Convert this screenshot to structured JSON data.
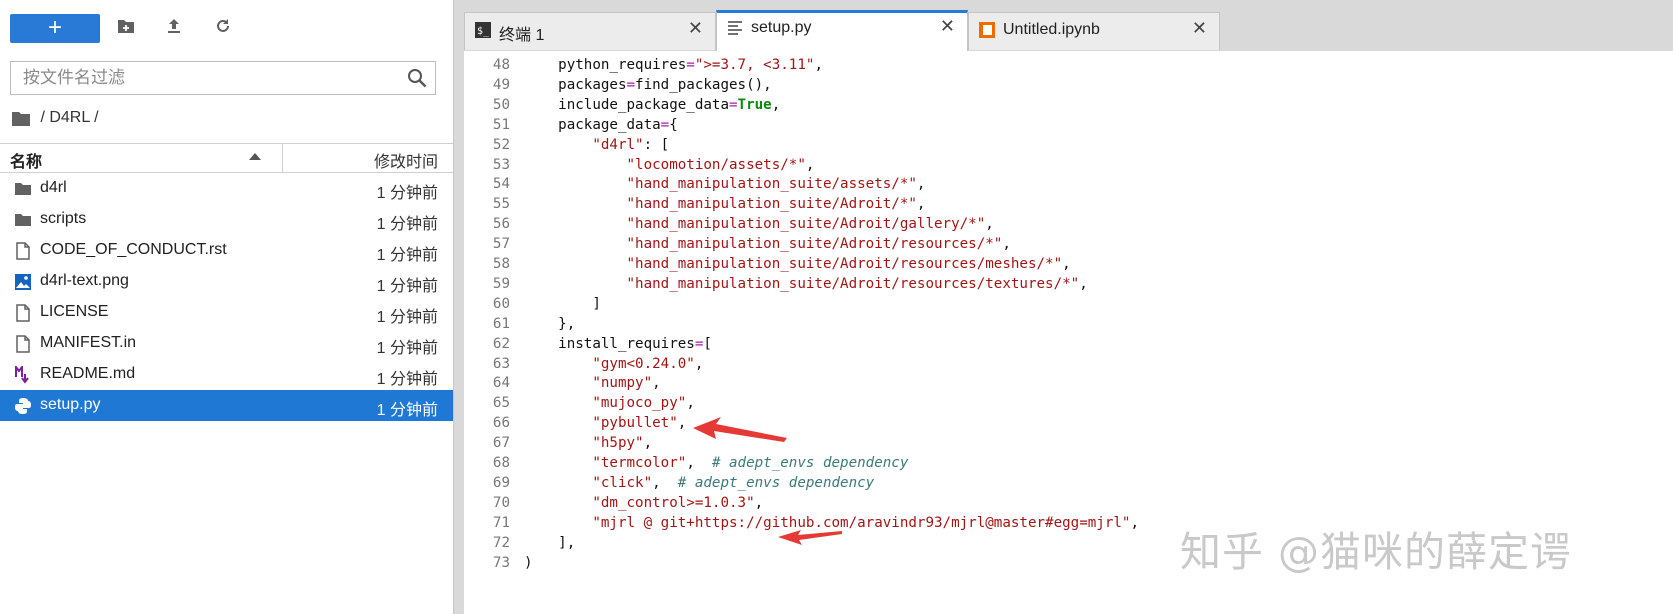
{
  "sidebar": {
    "toolbar": {
      "new_label": "+"
    },
    "filter_placeholder": "按文件名过滤",
    "breadcrumb": "/ D4RL /",
    "header": {
      "name": "名称",
      "modified": "修改时间"
    },
    "files": [
      {
        "name": "d4rl",
        "modified": "1 分钟前",
        "icon": "folder-icon"
      },
      {
        "name": "scripts",
        "modified": "1 分钟前",
        "icon": "folder-icon"
      },
      {
        "name": "CODE_OF_CONDUCT.rst",
        "modified": "1 分钟前",
        "icon": "file-icon"
      },
      {
        "name": "d4rl-text.png",
        "modified": "1 分钟前",
        "icon": "image-icon"
      },
      {
        "name": "LICENSE",
        "modified": "1 分钟前",
        "icon": "file-icon"
      },
      {
        "name": "MANIFEST.in",
        "modified": "1 分钟前",
        "icon": "file-icon"
      },
      {
        "name": "README.md",
        "modified": "1 分钟前",
        "icon": "markdown-icon"
      },
      {
        "name": "setup.py",
        "modified": "1 分钟前",
        "icon": "python-icon",
        "selected": true
      }
    ]
  },
  "tabs": [
    {
      "label": "终端 1",
      "icon": "terminal-icon"
    },
    {
      "label": "setup.py",
      "icon": "text-file-icon",
      "active": true
    },
    {
      "label": "Untitled.ipynb",
      "icon": "notebook-icon"
    }
  ],
  "editor": {
    "lines": [
      {
        "n": "48",
        "code": "    python_requires=\">=3.7, <3.11\","
      },
      {
        "n": "49",
        "code": "    packages=find_packages(),"
      },
      {
        "n": "50",
        "code": "    include_package_data=True,"
      },
      {
        "n": "51",
        "code": "    package_data={"
      },
      {
        "n": "52",
        "code": "        \"d4rl\": ["
      },
      {
        "n": "53",
        "code": "            \"locomotion/assets/*\","
      },
      {
        "n": "54",
        "code": "            \"hand_manipulation_suite/assets/*\","
      },
      {
        "n": "55",
        "code": "            \"hand_manipulation_suite/Adroit/*\","
      },
      {
        "n": "56",
        "code": "            \"hand_manipulation_suite/Adroit/gallery/*\","
      },
      {
        "n": "57",
        "code": "            \"hand_manipulation_suite/Adroit/resources/*\","
      },
      {
        "n": "58",
        "code": "            \"hand_manipulation_suite/Adroit/resources/meshes/*\","
      },
      {
        "n": "59",
        "code": "            \"hand_manipulation_suite/Adroit/resources/textures/*\","
      },
      {
        "n": "60",
        "code": "        ]"
      },
      {
        "n": "61",
        "code": "    },"
      },
      {
        "n": "62",
        "code": "    install_requires=["
      },
      {
        "n": "63",
        "code": "        \"gym<0.24.0\","
      },
      {
        "n": "64",
        "code": "        \"numpy\","
      },
      {
        "n": "65",
        "code": "        \"mujoco_py\","
      },
      {
        "n": "66",
        "code": "        \"pybullet\","
      },
      {
        "n": "67",
        "code": "        \"h5py\","
      },
      {
        "n": "68",
        "code": "        \"termcolor\",  # adept_envs dependency"
      },
      {
        "n": "69",
        "code": "        \"click\",  # adept_envs dependency"
      },
      {
        "n": "70",
        "code": "        \"dm_control>=1.0.3\","
      },
      {
        "n": "71",
        "code": "        \"mjrl @ git+https://github.com/aravindr93/mjrl@master#egg=mjrl\","
      },
      {
        "n": "72",
        "code": "    ],"
      },
      {
        "n": "73",
        "code": ")"
      }
    ]
  },
  "colors": {
    "accent": "#2979d6",
    "selected_row": "#1e78d4",
    "string": "#a31515",
    "keyword": "#0a8a0a",
    "operator": "#a51ca5",
    "comment": "#3c7a7a",
    "arrow": "#e53935"
  },
  "watermark": "知乎 @猫咪的薛定谔"
}
